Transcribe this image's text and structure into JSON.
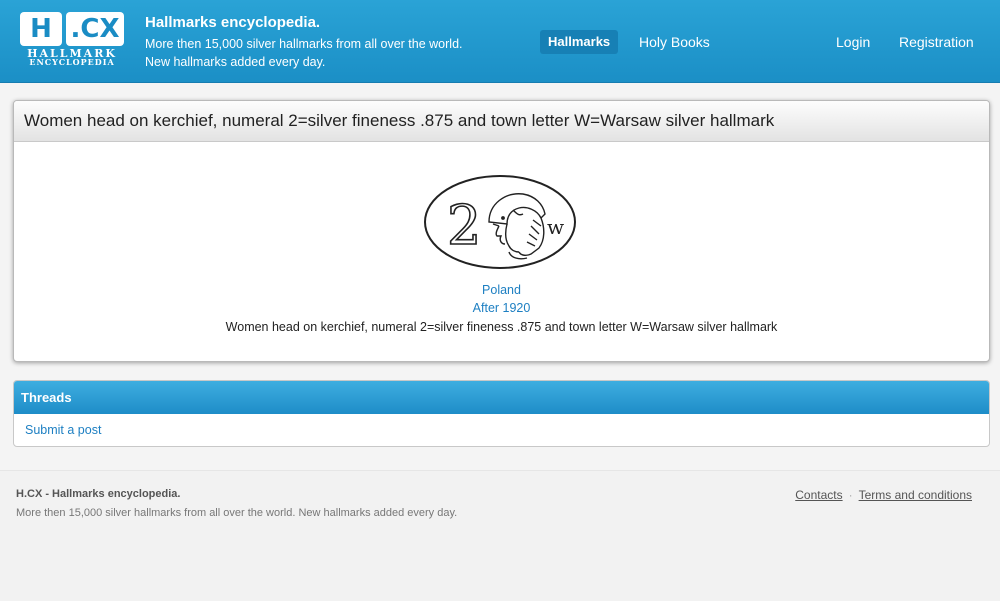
{
  "header": {
    "logo": {
      "top_left": "H",
      "top_right": ".CX",
      "line1": "HALLMARK",
      "line2": "ENCYCLOPEDIA"
    },
    "site_title": "Hallmarks encyclopedia.",
    "tagline_line1": "More then 15,000 silver hallmarks from all over the world.",
    "tagline_line2": "New hallmarks added every day.",
    "nav": {
      "hallmarks": "Hallmarks",
      "holy_books": "Holy Books",
      "login": "Login",
      "registration": "Registration"
    },
    "colors": {
      "bar": "#1f97cd",
      "active_nav": "#1780b5"
    }
  },
  "hallmark": {
    "title": "Women head on kerchief, numeral 2=silver fineness .875 and town letter W=Warsaw silver hallmark",
    "image_icon": "hallmark-drawing",
    "image_numeral": "2",
    "image_letter": "w",
    "country": "Poland",
    "date": "After 1920",
    "description": "Women head on kerchief, numeral 2=silver fineness .875 and town letter W=Warsaw silver hallmark"
  },
  "threads": {
    "heading": "Threads",
    "submit_label": "Submit a post"
  },
  "footer": {
    "title": "H.CX - Hallmarks encyclopedia.",
    "tagline": "More then 15,000 silver hallmarks from all over the world. New hallmarks added every day.",
    "links": {
      "contacts": "Contacts",
      "separator": "·",
      "terms": "Terms and conditions"
    }
  }
}
